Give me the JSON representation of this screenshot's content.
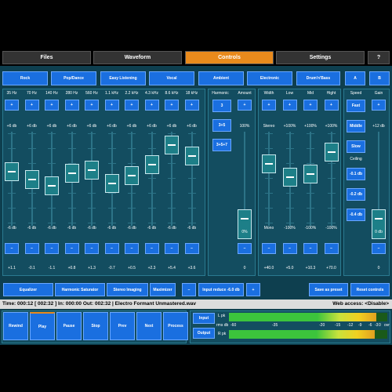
{
  "tabs": [
    {
      "label": "Files"
    },
    {
      "label": "Waveform"
    },
    {
      "label": "Controls"
    },
    {
      "label": "Settings"
    },
    {
      "label": "?"
    }
  ],
  "presets": [
    {
      "label": "Rock"
    },
    {
      "label": "Pop/Dance"
    },
    {
      "label": "Easy Listening"
    },
    {
      "label": "Vocal"
    },
    {
      "label": "Ambient"
    },
    {
      "label": "Electronic"
    },
    {
      "label": "Drum'n'Bass"
    },
    {
      "label": "A"
    },
    {
      "label": "B"
    }
  ],
  "eq": {
    "bands": [
      {
        "freq": "35 Hz",
        "top": "+6 db",
        "bottom": "-6 db",
        "value": "+1.1",
        "level": 0.59
      },
      {
        "freq": "70 Hz",
        "top": "+6 db",
        "bottom": "-6 db",
        "value": "-0.1",
        "level": 0.49
      },
      {
        "freq": "140 Hz",
        "top": "+6 db",
        "bottom": "-6 db",
        "value": "-1.1",
        "level": 0.41
      },
      {
        "freq": "280 Hz",
        "top": "+6 db",
        "bottom": "-6 db",
        "value": "+0.8",
        "level": 0.57
      },
      {
        "freq": "560 Hz",
        "top": "+6 db",
        "bottom": "-6 db",
        "value": "+1.3",
        "level": 0.61
      },
      {
        "freq": "1.1 kHz",
        "top": "+6 db",
        "bottom": "-6 db",
        "value": "-0.7",
        "level": 0.44
      },
      {
        "freq": "2.2 kHz",
        "top": "+6 db",
        "bottom": "-6 db",
        "value": "+0.5",
        "level": 0.54
      },
      {
        "freq": "4.3 kHz",
        "top": "+6 db",
        "bottom": "-6 db",
        "value": "+2.3",
        "level": 0.69
      },
      {
        "freq": "8.6 kHz",
        "top": "+6 db",
        "bottom": "-6 db",
        "value": "+5.4",
        "level": 0.95
      },
      {
        "freq": "18 kHz",
        "top": "+6 db",
        "bottom": "-6 db",
        "value": "+3.6",
        "level": 0.8
      }
    ]
  },
  "harmonic": {
    "label": "Harmonic",
    "options": [
      "3",
      "3+5",
      "3+5+7"
    ],
    "selected": "3"
  },
  "amount": {
    "label": "Amount",
    "top": "100%",
    "bottom": "0%",
    "value": "0",
    "knob_label": "0%",
    "level": 0.0
  },
  "compressor": [
    {
      "label": "Width",
      "top": "Stereo",
      "bottom": "Mono",
      "value": "+40.0",
      "level": 0.7
    },
    {
      "label": "Low",
      "top": "+100%",
      "bottom": "-100%",
      "value": "+5.0",
      "level": 0.52
    },
    {
      "label": "Mid",
      "top": "+100%",
      "bottom": "-100%",
      "value": "+10.3",
      "level": 0.56
    },
    {
      "label": "Hight",
      "top": "+100%",
      "bottom": "-100%",
      "value": "+70.0",
      "level": 0.85
    }
  ],
  "speed": {
    "label": "Speed",
    "options": [
      "Fast",
      "Middle",
      "Slow"
    ],
    "ceiling_label": "Ceiling",
    "ceiling_options": [
      "-0.1 db",
      "-0.2 db",
      "-0.4 db"
    ]
  },
  "gain": {
    "label": "Gain",
    "top": "+12 db",
    "bottom": "0 db",
    "value": "0",
    "level": 0.0
  },
  "plus": "+",
  "minus": "–",
  "modules": [
    {
      "label": "Equalizer"
    },
    {
      "label": "Harmonic Saturator"
    },
    {
      "label": "Stereo Imaging"
    },
    {
      "label": "Maximizer"
    }
  ],
  "input_reduce": "Input reduce -6.0 db",
  "save_preset": "Save as preset",
  "reset_controls": "Reset controls",
  "status": {
    "text": "Time: 000:12  [ 002:32 ]  In: 000:00  Out: 002:32  |  Electro Formant Unmastered.wav",
    "web_access": "Web access: <Disable>"
  },
  "transport": [
    {
      "label": "Rewind"
    },
    {
      "label": "Play"
    },
    {
      "label": "Pause"
    },
    {
      "label": "Stop"
    },
    {
      "label": "Prev"
    },
    {
      "label": "Next"
    },
    {
      "label": "Process"
    }
  ],
  "meter": {
    "input_label": "Input",
    "output_label": "Output",
    "l_label": "L pk",
    "rms_label": "rms db",
    "r_label": "R pk",
    "scale": [
      "-60",
      "-35",
      "-20",
      "-15",
      "-12",
      "-9",
      "-6",
      "-3",
      "0",
      "ovr"
    ],
    "left_level": 0.93,
    "right_level": 0.92
  },
  "colors": {
    "accent": "#e98a1c",
    "button": "#1a6fe0",
    "panel": "#0e3f4f",
    "knob": "#1d7f88"
  }
}
